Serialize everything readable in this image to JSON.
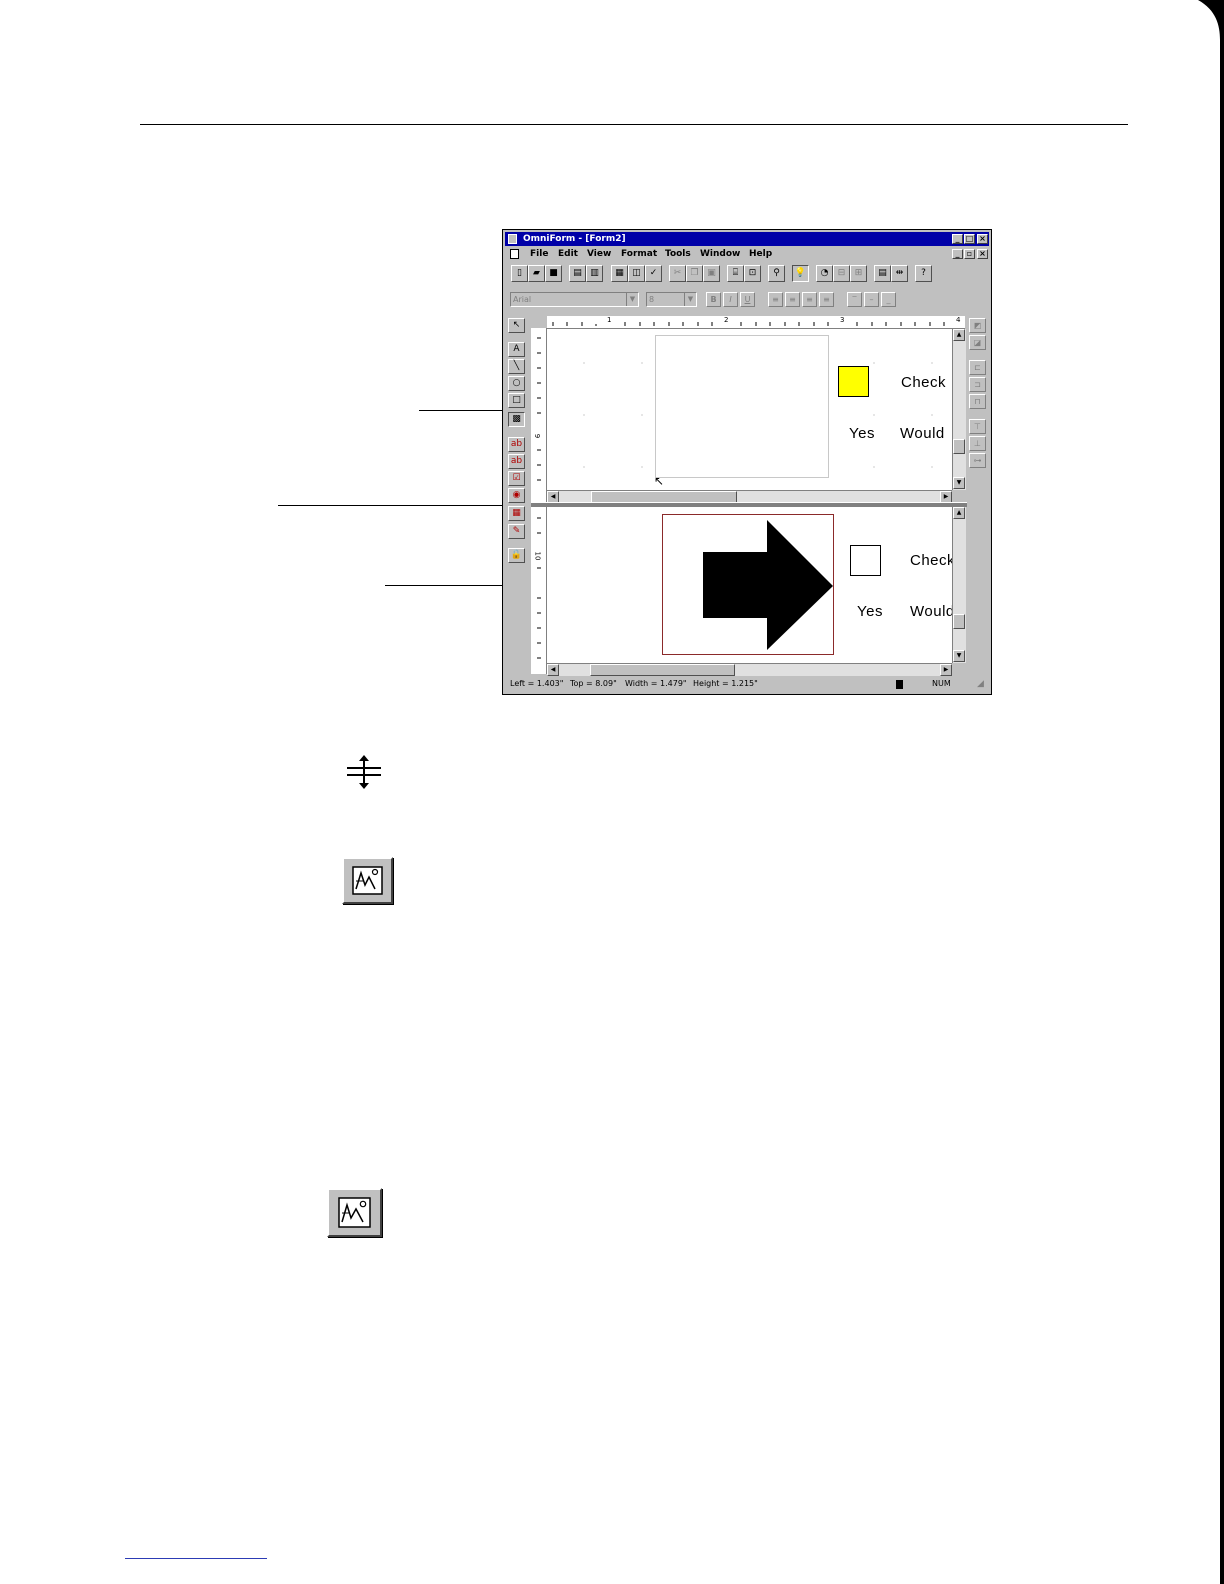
{
  "window": {
    "title": "OmniForm - [Form2]",
    "menu": [
      "File",
      "Edit",
      "View",
      "Format",
      "Tools",
      "Window",
      "Help"
    ],
    "font_name": "Arial",
    "font_size": "8",
    "ruler_numbers": [
      "1",
      "2",
      "3",
      "4"
    ],
    "vruler_numbers": [
      "9",
      "10"
    ],
    "form": {
      "check_label": "Check",
      "yes_label": "Yes",
      "would_label": "Would"
    },
    "status": {
      "left": "Left = 1.403\"",
      "top": "Top = 8.09\"",
      "width": "Width = 1.479\"",
      "height": "Height = 1.215\"",
      "num": "NUM"
    }
  },
  "colors": {
    "title_bar": "#0000a8",
    "checkbox_fill": "#ffff00",
    "footer_rule": "#2c3bb5",
    "selection_border": "#8b2a2a"
  },
  "icons": {
    "split_cursor": "split-cursor-icon",
    "picture_tool": "picture-tool-icon"
  }
}
